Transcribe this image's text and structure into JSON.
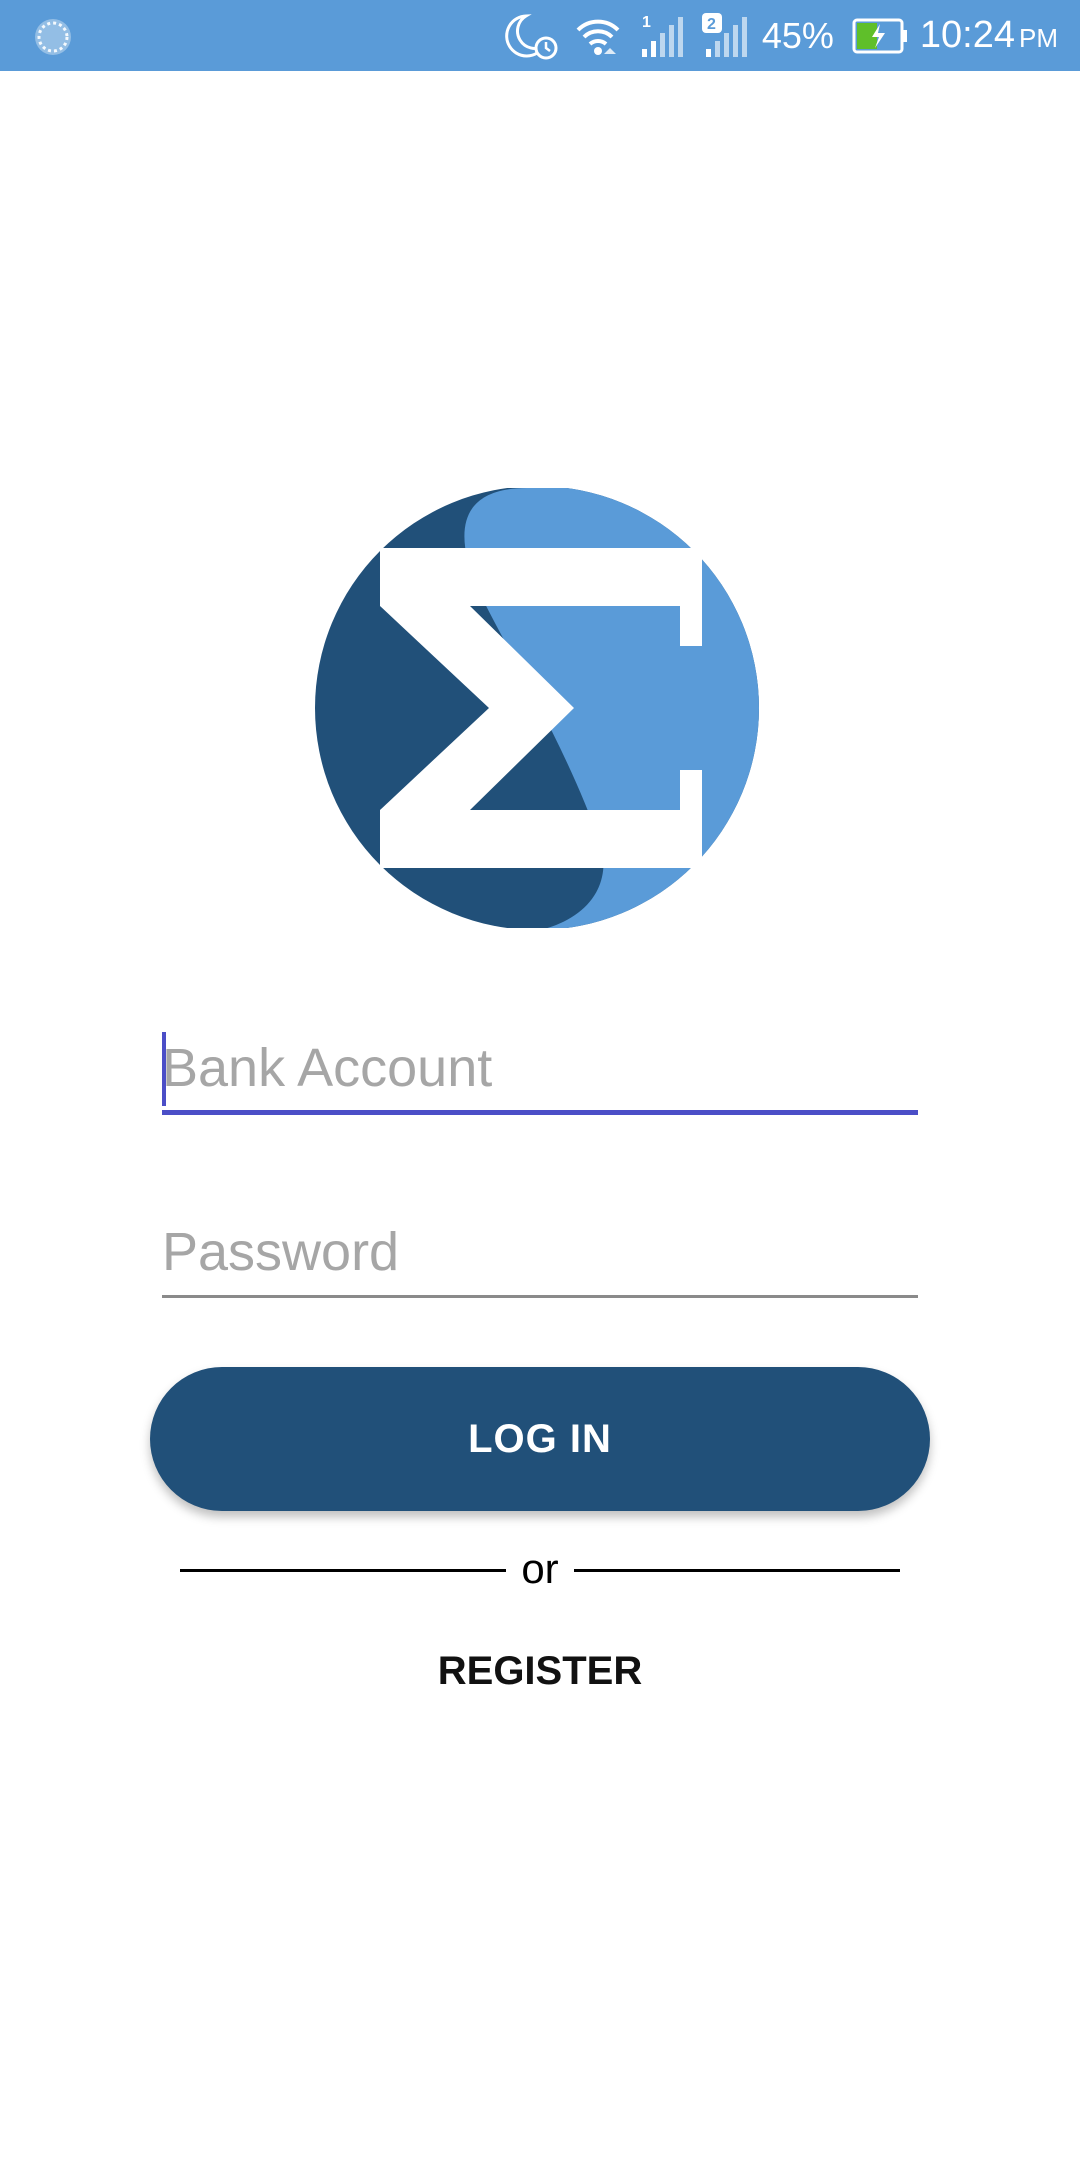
{
  "status_bar": {
    "battery_percent": "45%",
    "time": "10:24",
    "ampm": "PM",
    "sim1_label": "1",
    "sim2_label": "2",
    "background_color": "#5a9bd8",
    "icons": [
      "loading-icon",
      "moon-icon",
      "alarm-icon",
      "wifi-icon",
      "signal-sim1-icon",
      "signal-sim2-icon",
      "battery-charging-icon"
    ]
  },
  "logo": {
    "symbol": "sigma",
    "colors": {
      "dark": "#215079",
      "light": "#5a9bd8",
      "glyph": "#ffffff"
    }
  },
  "form": {
    "bank_account": {
      "placeholder": "Bank Account",
      "value": ""
    },
    "password": {
      "placeholder": "Password",
      "value": ""
    },
    "focus_color": "#4b4ec7"
  },
  "actions": {
    "login_label": "LOG IN",
    "divider_text": "or",
    "register_label": "REGISTER",
    "login_color": "#215079"
  }
}
